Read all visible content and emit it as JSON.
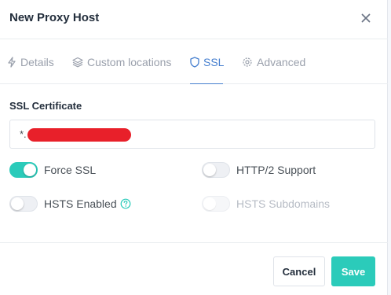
{
  "modal": {
    "title": "New Proxy Host"
  },
  "tabs": [
    {
      "label": "Details",
      "icon": "zap-icon",
      "active": false
    },
    {
      "label": "Custom locations",
      "icon": "layers-icon",
      "active": false
    },
    {
      "label": "SSL",
      "icon": "shield-icon",
      "active": true
    },
    {
      "label": "Advanced",
      "icon": "gear-icon",
      "active": false
    }
  ],
  "ssl": {
    "certificate_label": "SSL Certificate",
    "certificate_value": "*."
  },
  "toggles": {
    "force_ssl": {
      "label": "Force SSL",
      "on": true,
      "disabled": false
    },
    "http2": {
      "label": "HTTP/2 Support",
      "on": false,
      "disabled": false
    },
    "hsts_enabled": {
      "label": "HSTS Enabled",
      "on": false,
      "disabled": false
    },
    "hsts_subdomains": {
      "label": "HSTS Subdomains",
      "on": false,
      "disabled": true
    }
  },
  "footer": {
    "cancel_label": "Cancel",
    "save_label": "Save"
  },
  "colors": {
    "accent": "#2bcbba",
    "tab_active": "#467fcf",
    "redaction": "#e8202a"
  }
}
